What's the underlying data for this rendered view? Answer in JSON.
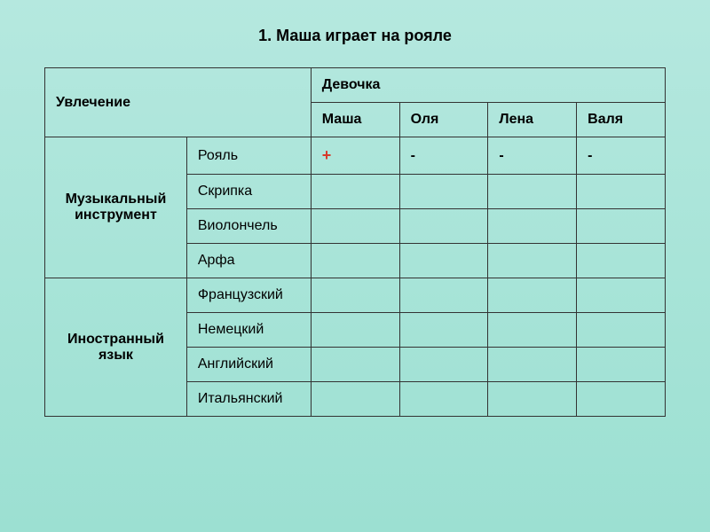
{
  "title": "1. Маша играет на рояле",
  "headers": {
    "hobby": "Увлечение",
    "girl": "Девочка",
    "girls": [
      "Маша",
      "Оля",
      "Лена",
      "Валя"
    ]
  },
  "sections": [
    {
      "label_line1": "Музыкальный",
      "label_line2": "инструмент",
      "rows": [
        {
          "item": "Рояль",
          "cells": [
            "+",
            "-",
            "-",
            "-"
          ]
        },
        {
          "item": "Скрипка",
          "cells": [
            "",
            "",
            "",
            ""
          ]
        },
        {
          "item": "Виолончель",
          "cells": [
            "",
            "",
            "",
            ""
          ]
        },
        {
          "item": "Арфа",
          "cells": [
            "",
            "",
            "",
            ""
          ]
        }
      ]
    },
    {
      "label_line1": "Иностранный",
      "label_line2": "язык",
      "rows": [
        {
          "item": "Французский",
          "cells": [
            "",
            "",
            "",
            ""
          ]
        },
        {
          "item": "Немецкий",
          "cells": [
            "",
            "",
            "",
            ""
          ]
        },
        {
          "item": "Английский",
          "cells": [
            "",
            "",
            "",
            ""
          ]
        },
        {
          "item": "Итальянский",
          "cells": [
            "",
            "",
            "",
            ""
          ]
        }
      ]
    }
  ],
  "chart_data": {
    "type": "table",
    "title": "1. Маша играет на рояле",
    "row_group_header": "Увлечение",
    "col_group_header": "Девочка",
    "columns": [
      "Маша",
      "Оля",
      "Лена",
      "Валя"
    ],
    "groups": [
      {
        "name": "Музыкальный инструмент",
        "rows": [
          {
            "label": "Рояль",
            "values": [
              "+",
              "-",
              "-",
              "-"
            ]
          },
          {
            "label": "Скрипка",
            "values": [
              "",
              "",
              "",
              ""
            ]
          },
          {
            "label": "Виолончель",
            "values": [
              "",
              "",
              "",
              ""
            ]
          },
          {
            "label": "Арфа",
            "values": [
              "",
              "",
              "",
              ""
            ]
          }
        ]
      },
      {
        "name": "Иностранный язык",
        "rows": [
          {
            "label": "Французский",
            "values": [
              "",
              "",
              "",
              ""
            ]
          },
          {
            "label": "Немецкий",
            "values": [
              "",
              "",
              "",
              ""
            ]
          },
          {
            "label": "Английский",
            "values": [
              "",
              "",
              "",
              ""
            ]
          },
          {
            "label": "Итальянский",
            "values": [
              "",
              "",
              "",
              ""
            ]
          }
        ]
      }
    ]
  }
}
